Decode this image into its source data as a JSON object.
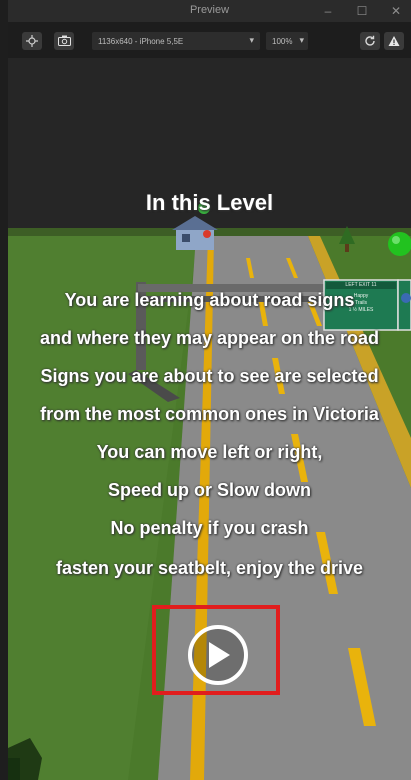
{
  "window": {
    "title": "Preview"
  },
  "toolbar": {
    "device": "1136x640 - iPhone 5,5E",
    "zoom": "100%"
  },
  "sign": {
    "line1": "LEFT EXIT 11",
    "line2": "Happy",
    "line3": "Trails",
    "line4": "1 ½ MILES"
  },
  "overlay": {
    "title": "In this Level",
    "lines": [
      "You are learning about road signs",
      "and where they may appear on the road",
      "Signs you are about to see are selected",
      "from the most common ones in Victoria",
      "You can move left or right,",
      "Speed up or Slow down",
      "No penalty if you crash",
      "fasten your seatbelt, enjoy the drive"
    ]
  },
  "colors": {
    "highlight": "#e11d1d",
    "grass": "#4f7b2f",
    "road": "#8c8c8c",
    "road_line": "#f2b705",
    "sign_green": "#1e7a52"
  }
}
